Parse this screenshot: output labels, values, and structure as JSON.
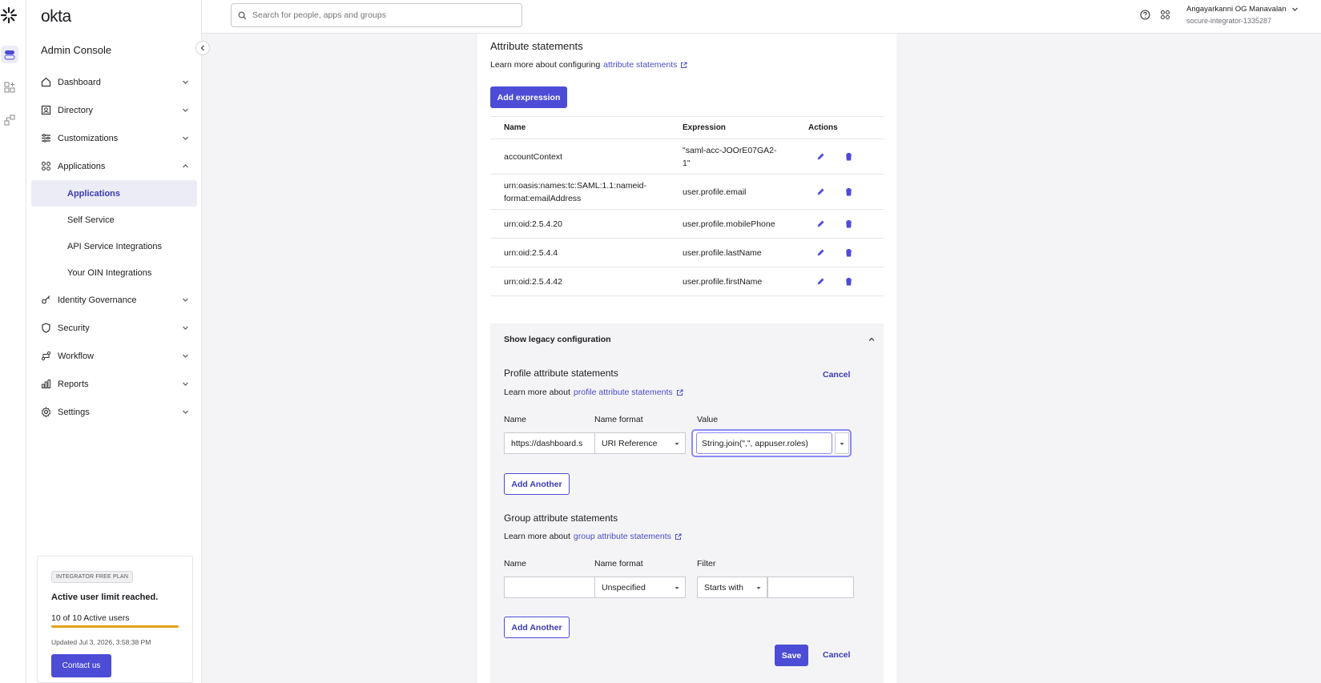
{
  "brand": {
    "name": "okta"
  },
  "sidebar": {
    "title": "Admin Console",
    "items": [
      {
        "label": "Dashboard",
        "icon": "home-icon"
      },
      {
        "label": "Directory",
        "icon": "directory-icon"
      },
      {
        "label": "Customizations",
        "icon": "sliders-icon"
      },
      {
        "label": "Applications",
        "icon": "apps-icon",
        "expanded": true
      },
      {
        "label": "Identity Governance",
        "icon": "key-icon"
      },
      {
        "label": "Security",
        "icon": "shield-icon"
      },
      {
        "label": "Workflow",
        "icon": "workflow-icon"
      },
      {
        "label": "Reports",
        "icon": "chart-icon"
      },
      {
        "label": "Settings",
        "icon": "gear-icon"
      }
    ],
    "subitems": [
      "Applications",
      "Self Service",
      "API Service Integrations",
      "Your OIN Integrations"
    ],
    "plan": {
      "badge": "INTEGRATOR FREE PLAN",
      "title": "Active user limit reached.",
      "users": "10 of 10 Active users",
      "progress": 1.0,
      "updated": "Updated Jul 3, 2026, 3:58:38 PM",
      "contact": "Contact us"
    }
  },
  "topbar": {
    "search_placeholder": "Search for people, apps and groups",
    "user_name": "Angayarkanni OG Manavalan",
    "org": "socure-integrator-1335287"
  },
  "attributes": {
    "title": "Attribute statements",
    "learn_prefix": "Learn more about configuring",
    "learn_link": "attribute statements",
    "add_button": "Add expression",
    "headers": {
      "name": "Name",
      "expression": "Expression",
      "actions": "Actions"
    },
    "rows": [
      {
        "name": "accountContext",
        "expression": "\"saml-acc-JOOrE07GA2-1\""
      },
      {
        "name": "urn:oasis:names:tc:SAML:1.1:nameid-format:emailAddress",
        "expression": "user.profile.email"
      },
      {
        "name": "urn:oid:2.5.4.20",
        "expression": "user.profile.mobilePhone"
      },
      {
        "name": "urn:oid:2.5.4.4",
        "expression": "user.profile.lastName"
      },
      {
        "name": "urn:oid:2.5.4.42",
        "expression": "user.profile.firstName"
      }
    ]
  },
  "legacy": {
    "toggle_label": "Show legacy configuration",
    "profile": {
      "title": "Profile attribute statements",
      "cancel": "Cancel",
      "learn_prefix": "Learn more about",
      "learn_link": "profile attribute statements",
      "col_name": "Name",
      "col_format": "Name format",
      "col_value": "Value",
      "name_value": "https://dashboard.s",
      "format_value": "URI Reference",
      "value_value": "String.join(\",\", appuser.roles)",
      "add_another": "Add Another"
    },
    "group": {
      "title": "Group attribute statements",
      "learn_prefix": "Learn more about",
      "learn_link": "group attribute statements",
      "col_name": "Name",
      "col_format": "Name format",
      "col_filter": "Filter",
      "format_value": "Unspecified",
      "filter_value": "Starts with",
      "add_another": "Add Another"
    },
    "save": "Save",
    "cancel": "Cancel"
  }
}
